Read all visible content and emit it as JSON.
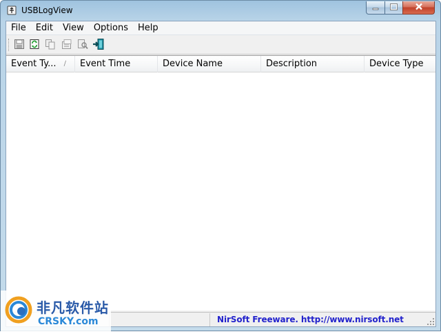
{
  "window": {
    "title": "USBLogView",
    "controls": {
      "minimize": "minimize",
      "maximize": "maximize",
      "close": "close"
    }
  },
  "menu": {
    "items": [
      {
        "id": "file",
        "label": "File"
      },
      {
        "id": "edit",
        "label": "Edit"
      },
      {
        "id": "view",
        "label": "View"
      },
      {
        "id": "options",
        "label": "Options"
      },
      {
        "id": "help",
        "label": "Help"
      }
    ]
  },
  "toolbar": {
    "buttons": [
      {
        "id": "save",
        "icon": "save-icon"
      },
      {
        "id": "refresh",
        "icon": "refresh-icon"
      },
      {
        "id": "copy",
        "icon": "copy-icon"
      },
      {
        "id": "properties",
        "icon": "properties-icon"
      },
      {
        "id": "find",
        "icon": "find-icon"
      },
      {
        "id": "exit",
        "icon": "exit-icon"
      }
    ]
  },
  "list": {
    "columns": [
      {
        "id": "event-type",
        "label": "Event Ty...",
        "sorted": true
      },
      {
        "id": "event-time",
        "label": "Event Time"
      },
      {
        "id": "device-name",
        "label": "Device Name"
      },
      {
        "id": "description",
        "label": "Description"
      },
      {
        "id": "device-type",
        "label": "Device Type"
      }
    ],
    "rows": []
  },
  "statusbar": {
    "link_text": "NirSoft Freeware.  http://www.nirsoft.net"
  },
  "watermark": {
    "cn_text": "非凡软件站",
    "en_text": "CRSKY.com"
  },
  "colors": {
    "accent_link": "#2222cc",
    "close_button": "#c0412a",
    "titlebar": "#9fc3df"
  }
}
